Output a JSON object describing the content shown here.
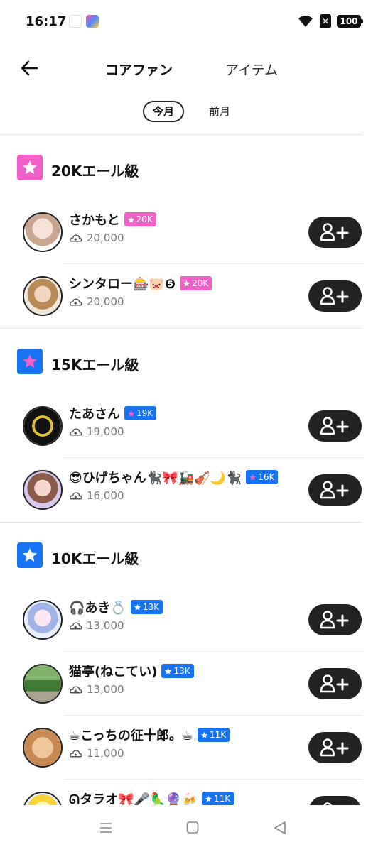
{
  "status": {
    "time": "16:17",
    "battery": "100",
    "sim_glyph": "✕",
    "icons": [
      "app-icon",
      "app-icon-colorful",
      "wifi-icon",
      "sim-icon",
      "battery-icon"
    ]
  },
  "header": {
    "back_icon": "arrow-left-icon",
    "tabs": [
      {
        "label": "コアファン",
        "active": true
      },
      {
        "label": "アイテム",
        "active": false
      }
    ]
  },
  "period": {
    "selected": "今月",
    "other": "前月"
  },
  "colors": {
    "pink": "#f35fc9",
    "blue": "#1673f3",
    "dark": "#222222"
  },
  "sections": [
    {
      "title": "20Kエール級",
      "color": "pink",
      "fans": [
        {
          "name": "さかもと",
          "badge": "20K",
          "badge_color": "pink",
          "points": "20,000"
        },
        {
          "name": "シンタロー🎰🐷❺",
          "badge": "20K",
          "badge_color": "pink",
          "points": "20,000"
        }
      ]
    },
    {
      "title": "15Kエール級",
      "color": "blue",
      "fans": [
        {
          "name": "たあさん",
          "badge": "19K",
          "badge_color": "blue",
          "points": "19,000"
        },
        {
          "name": "😎ひげちゃん🐈‍⬛🎀🚂🎻🌙🐈‍⬛",
          "badge": "16K",
          "badge_color": "blue",
          "points": "16,000"
        }
      ]
    },
    {
      "title": "10Kエール級",
      "color": "blue",
      "fans": [
        {
          "name": "🎧あき💍",
          "badge": "13K",
          "badge_color": "blue",
          "points": "13,000"
        },
        {
          "name": "猫亭(ねこてい)",
          "badge": "13K",
          "badge_color": "blue",
          "points": "13,000"
        },
        {
          "name": "☕こっちの征十郎。☕",
          "badge": "11K",
          "badge_color": "blue",
          "points": "11,000"
        },
        {
          "name": "ᘏタラオ🎀🎤🦜🔮🍻",
          "badge": "11K",
          "badge_color": "blue",
          "points": ""
        }
      ]
    }
  ],
  "nav": {
    "items": [
      "menu-icon",
      "home-icon",
      "back-icon"
    ]
  }
}
